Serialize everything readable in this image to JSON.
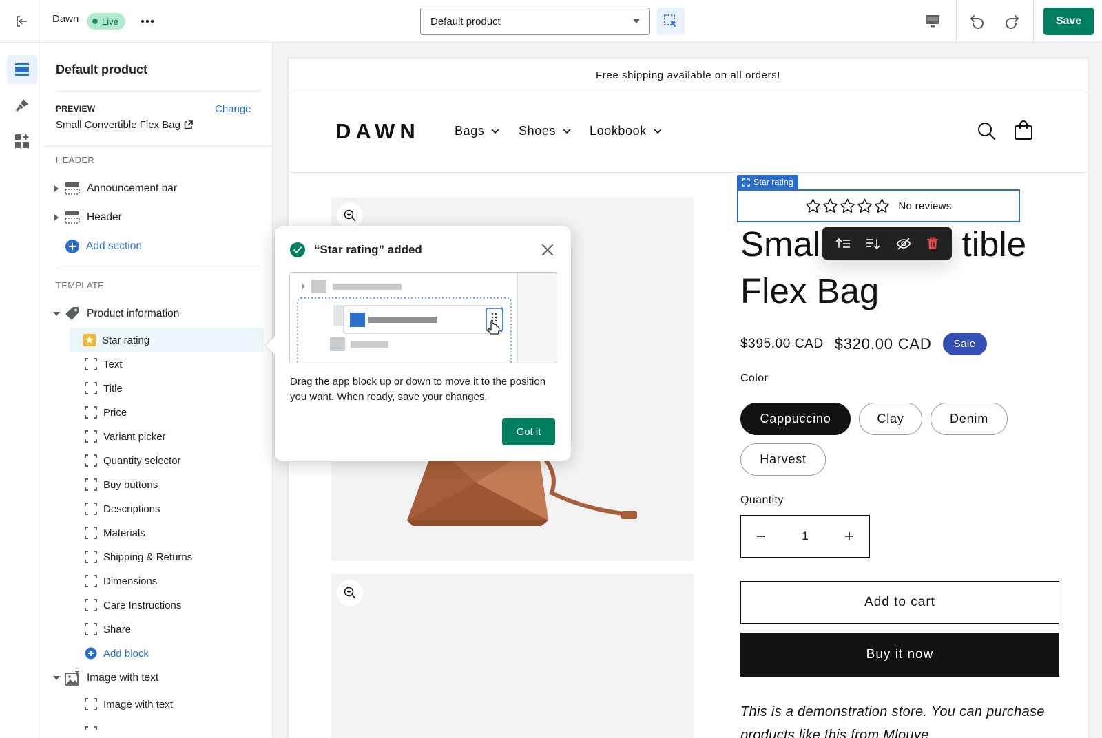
{
  "topbar": {
    "theme_name": "Dawn",
    "live_badge": "Live",
    "template_select": "Default product",
    "save_label": "Save"
  },
  "sidebar": {
    "title": "Default product",
    "preview_label": "PREVIEW",
    "change_label": "Change",
    "preview_product": "Small Convertible Flex Bag",
    "header_label": "HEADER",
    "header_sections": [
      "Announcement bar",
      "Header"
    ],
    "add_section": "Add section",
    "template_label": "TEMPLATE",
    "product_information": "Product information",
    "blocks": [
      "Star rating",
      "Text",
      "Title",
      "Price",
      "Variant picker",
      "Quantity selector",
      "Buy buttons",
      "Descriptions",
      "Materials",
      "Shipping & Returns",
      "Dimensions",
      "Care Instructions",
      "Share"
    ],
    "add_block": "Add block",
    "image_with_text_section": "Image with text",
    "image_with_text_block": "Image with text"
  },
  "popover": {
    "title": "“Star rating” added",
    "body": "Drag the app block up or down to move it to the position you want. When ready, save your changes.",
    "got_it": "Got it"
  },
  "store": {
    "announcement": "Free shipping available on all orders!",
    "logo": "DAWN",
    "nav": [
      "Bags",
      "Shoes",
      "Lookbook"
    ],
    "star_rating_tag": "Star rating",
    "no_reviews": "No reviews",
    "rating_stars": 0,
    "product_title_line1_a": "Small",
    "product_title_line1_b": "tible",
    "product_title_line2": "Flex Bag",
    "price_original": "$395.00 CAD",
    "price_sale": "$320.00 CAD",
    "sale_badge": "Sale",
    "color_label": "Color",
    "colors": [
      "Cappuccino",
      "Clay",
      "Denim",
      "Harvest"
    ],
    "selected_color": "Cappuccino",
    "quantity_label": "Quantity",
    "quantity_value": "1",
    "add_to_cart": "Add to cart",
    "buy_now": "Buy it now",
    "description_line1": "This is a demonstration store. You can purchase",
    "description_line2": "products like this from Mlouye"
  },
  "colors": {
    "save_green": "#008060",
    "link_blue": "#2c6ecb",
    "sale_blue": "#334fb4",
    "selected_row": "#ecf7fb"
  }
}
